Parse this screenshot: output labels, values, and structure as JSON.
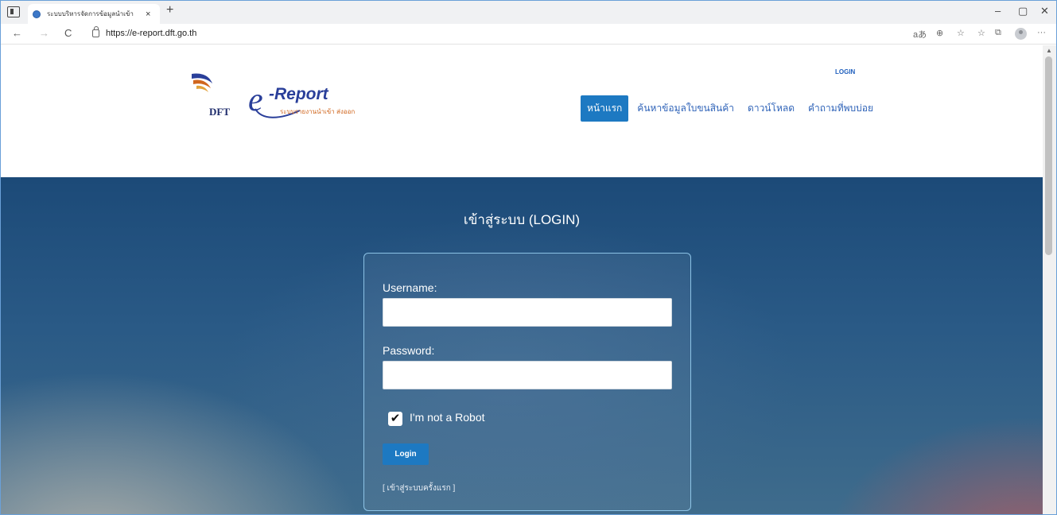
{
  "browser": {
    "tab_title": "ระบบบริหารจัดการข้อมูลนำเข้า",
    "tab_close": "×",
    "new_tab": "+",
    "url": "https://e-report.dft.go.th",
    "nav": {
      "back": "←",
      "forward": "→",
      "reload": "C"
    },
    "window_controls": {
      "minimize": "–",
      "restore": "▢",
      "close": "✕"
    },
    "toolbar": {
      "read_aloud": "aあ",
      "zoom": "⊕",
      "favorite": "☆",
      "favorites": "☆",
      "collections": "⧉",
      "more": "···"
    }
  },
  "header": {
    "logo": {
      "dft": "DFT",
      "e": "e",
      "report": "-Report",
      "subtitle": "ระบบรายงานนำเข้า ส่งออก"
    },
    "login_link": "LOGIN",
    "menu": [
      {
        "label": "หน้าแรก",
        "active": true
      },
      {
        "label": "ค้นหาข้อมูลใบขนสินค้า",
        "active": false
      },
      {
        "label": "ดาวน์โหลด",
        "active": false
      },
      {
        "label": "คำถามที่พบบ่อย",
        "active": false
      }
    ]
  },
  "login": {
    "title": "เข้าสู่ระบบ (LOGIN)",
    "username_label": "Username:",
    "username_value": "",
    "password_label": "Password:",
    "password_value": "",
    "robot_checked": true,
    "robot_label": "I'm not a Robot",
    "button_label": "Login",
    "first_login_link": "[ เข้าสู่ระบบครั้งแรก ]"
  },
  "colors": {
    "accent": "#1d79c2",
    "link": "#2f63b8",
    "logo_blue": "#2a3f9a",
    "logo_orange": "#d0661e"
  }
}
